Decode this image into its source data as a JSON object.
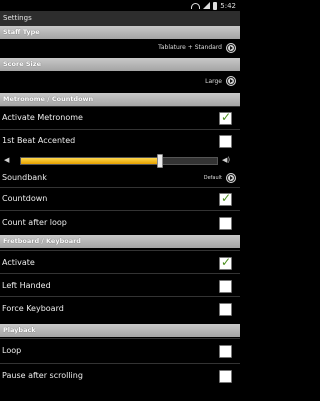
{
  "status": {
    "time": "5:42"
  },
  "titlebar": {
    "title": "Settings"
  },
  "sections": {
    "staff_type": {
      "header": "Staff Type",
      "value": "Tablature + Standard"
    },
    "score_size": {
      "header": "Score Size",
      "value": "Large"
    },
    "metronome": {
      "header": "Metronome / Countdown",
      "items": [
        {
          "label": "Activate Metronome",
          "checked": true
        },
        {
          "label": "1st Beat Accented",
          "checked": false
        }
      ],
      "volume_percent": 71,
      "soundbank": {
        "label": "Soundbank",
        "value": "Default"
      },
      "items2": [
        {
          "label": "Countdown",
          "checked": true
        },
        {
          "label": "Count after loop",
          "checked": false
        }
      ]
    },
    "fretboard": {
      "header": "Fretboard / Keyboard",
      "items": [
        {
          "label": "Activate",
          "checked": true
        },
        {
          "label": "Left Handed",
          "checked": false
        },
        {
          "label": "Force Keyboard",
          "checked": false
        }
      ]
    },
    "playback": {
      "header": "Playback",
      "items": [
        {
          "label": "Loop",
          "checked": false
        },
        {
          "label": "Pause after scrolling",
          "checked": false
        }
      ]
    }
  }
}
